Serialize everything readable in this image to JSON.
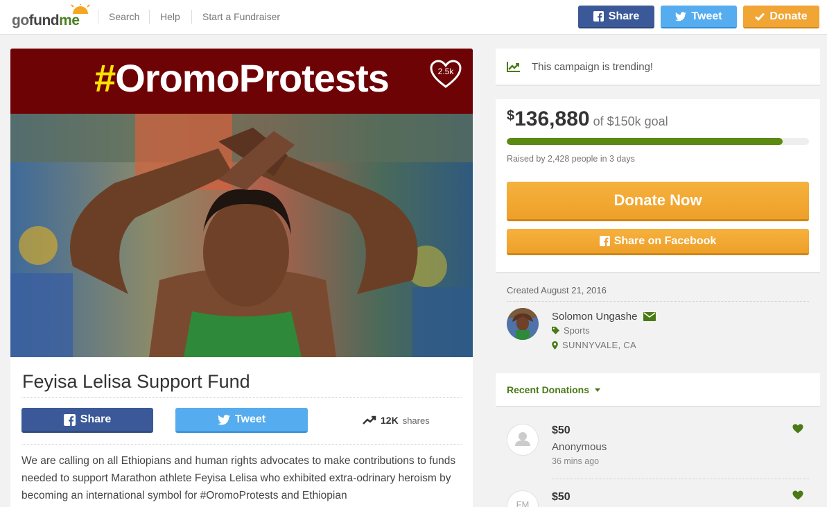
{
  "header": {
    "logo": {
      "go": "go",
      "fund": "fund",
      "me": "me"
    },
    "nav": [
      "Search",
      "Help",
      "Start a Fundraiser"
    ],
    "share_label": "Share",
    "tweet_label": "Tweet",
    "donate_label": "Donate"
  },
  "hero": {
    "hash": "#",
    "hashtag": "OromoProtests",
    "heart_count": "2.5k"
  },
  "campaign": {
    "title": "Feyisa Lelisa Support Fund",
    "share_label": "Share",
    "tweet_label": "Tweet",
    "shares_count": "12K",
    "shares_label": "shares",
    "story": "We are calling on all Ethiopians and human rights advocates to make contributions to funds needed to support Marathon athlete Feyisa Lelisa who exhibited extra-odrinary heroism by becoming an international symbol for #OromoProtests and Ethiopian"
  },
  "sidebar": {
    "trending_text": "This campaign is trending!",
    "currency": "$",
    "amount_raised": "136,880",
    "goal_text": "of $150k goal",
    "progress_fraction": 0.913,
    "raised_by": "Raised by 2,428 people in 3 days",
    "donate_now": "Donate Now",
    "share_facebook": "Share on Facebook",
    "created": "Created August 21, 2016",
    "organizer": {
      "name": "Solomon Ungashe",
      "category": "Sports",
      "location": "SUNNYVALE, CA"
    },
    "recent_donations_label": "Recent Donations",
    "donations": [
      {
        "amount": "$50",
        "name": "Anonymous",
        "time": "36 mins ago"
      },
      {
        "amount": "$50",
        "initials": "FM"
      }
    ]
  },
  "colors": {
    "facebook": "#3b5998",
    "twitter": "#55acee",
    "orange": "#f0a535",
    "green": "#5b8a12",
    "banner": "#6e0306"
  }
}
